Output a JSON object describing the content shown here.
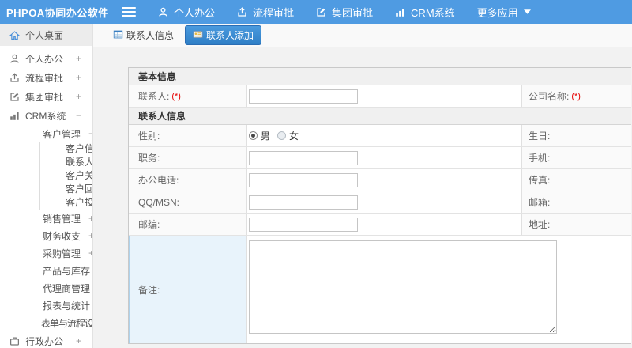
{
  "topbar": {
    "logo": "PHPOA协同办公软件",
    "menu": [
      {
        "label": "个人办公",
        "icon": "user-icon"
      },
      {
        "label": "流程审批",
        "icon": "upload-icon"
      },
      {
        "label": "集团审批",
        "icon": "edit-icon"
      },
      {
        "label": "CRM系统",
        "icon": "chart-icon"
      },
      {
        "label": "更多应用",
        "icon": "caret-down-icon"
      }
    ]
  },
  "sidebar": {
    "items": [
      {
        "label": "个人桌面",
        "toggle": ""
      },
      {
        "label": "个人办公",
        "toggle": "+"
      },
      {
        "label": "流程审批",
        "toggle": "+"
      },
      {
        "label": "集团审批",
        "toggle": "+"
      },
      {
        "label": "CRM系统",
        "toggle": "−"
      },
      {
        "label": "客户管理",
        "toggle": "−"
      },
      {
        "label": "客户信息",
        "toggle": ""
      },
      {
        "label": "联系人",
        "toggle": ""
      },
      {
        "label": "客户关怀",
        "toggle": ""
      },
      {
        "label": "客户回访",
        "toggle": ""
      },
      {
        "label": "客户投诉",
        "toggle": ""
      },
      {
        "label": "销售管理",
        "toggle": "+"
      },
      {
        "label": "财务收支",
        "toggle": "+"
      },
      {
        "label": "采购管理",
        "toggle": "+"
      },
      {
        "label": "产品与库存",
        "toggle": "+"
      },
      {
        "label": "代理商管理",
        "toggle": "+"
      },
      {
        "label": "报表与统计",
        "toggle": ""
      },
      {
        "label": "表单与流程设置",
        "toggle": "+"
      },
      {
        "label": "行政办公",
        "toggle": "+"
      }
    ]
  },
  "tabs": [
    {
      "label": "联系人信息",
      "active": false
    },
    {
      "label": "联系人添加",
      "active": true
    }
  ],
  "form": {
    "required_mark": "(*)",
    "section1": {
      "title": "基本信息"
    },
    "section2": {
      "title": "联系人信息"
    },
    "rows": {
      "contact": {
        "label": "联系人:",
        "right": "公司名称:",
        "value": ""
      },
      "gender": {
        "label": "性别:",
        "right": "生日:",
        "male": "男",
        "female": "女",
        "selected": "男"
      },
      "position": {
        "label": "职务:",
        "right": "手机:",
        "value": ""
      },
      "office_phone": {
        "label": "办公电话:",
        "right": "传真:",
        "value": ""
      },
      "qq_msn": {
        "label": "QQ/MSN:",
        "right": "邮箱:",
        "value": ""
      },
      "zip": {
        "label": "邮编:",
        "right": "地址:",
        "value": ""
      },
      "remark": {
        "label": "备注:",
        "value": ""
      }
    }
  },
  "colors": {
    "topbar_blue": "#4f9be2",
    "active_tab_blue": "#2f7fc6",
    "required_red": "#e60000",
    "remark_highlight": "#e8f3fb",
    "section_header_bg": "#f0f0f0"
  }
}
